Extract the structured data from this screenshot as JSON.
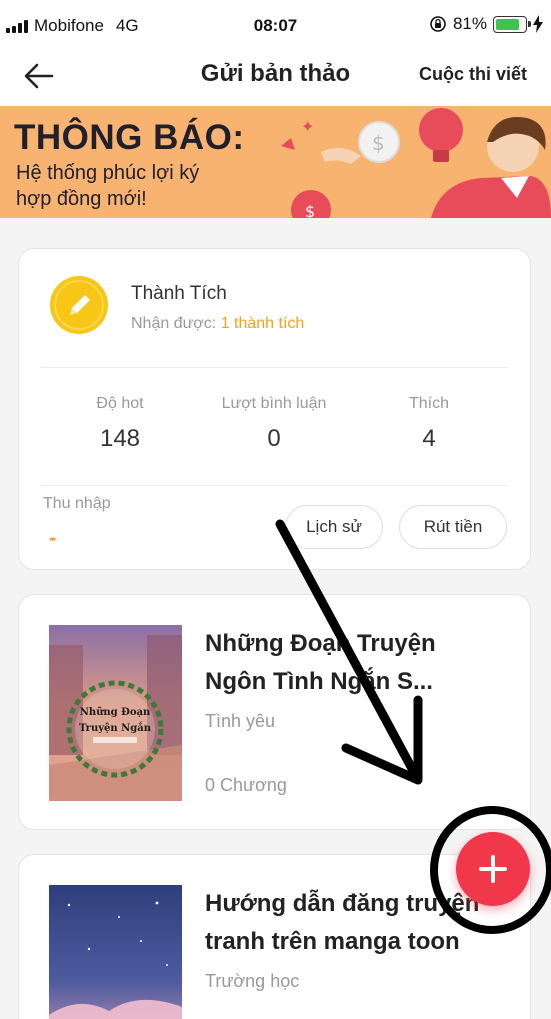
{
  "status_bar": {
    "carrier": "Mobifone",
    "network": "4G",
    "time": "08:07",
    "battery_percent": "81%",
    "battery_level": 0.81,
    "battery_color": "#3cc54a"
  },
  "nav": {
    "back_icon": "arrow-left-icon",
    "title": "Gửi bản thảo",
    "right_link": "Cuộc thi viết"
  },
  "banner": {
    "title": "THÔNG BÁO:",
    "subtitle_line1": "Hệ thống phúc lợi ký",
    "subtitle_line2": "hợp đồng mới!",
    "background": "#f8b370"
  },
  "achievement": {
    "icon": "pencil-badge-icon",
    "title": "Thành Tích",
    "received_label": "Nhận được: ",
    "received_value": "1 thành tích",
    "stats": [
      {
        "label": "Độ hot",
        "value": "148"
      },
      {
        "label": "Lượt bình luận",
        "value": "0"
      },
      {
        "label": "Thích",
        "value": "4"
      }
    ],
    "income_label": "Thu nhập",
    "income_value": "-",
    "history_button": "Lịch sử",
    "withdraw_button": "Rút tiền",
    "accent_color": "#f3a21a"
  },
  "stories": [
    {
      "title_line1": "Những Đoạn Truyện",
      "title_line2": "Ngôn Tình Ngắn S...",
      "genre": "Tình yêu",
      "chapters": "0 Chương",
      "cover_text_line1": "Những Đoạn",
      "cover_text_line2": "Truyện Ngắn"
    },
    {
      "title_line1": "Hướng dẫn đăng truyện",
      "title_line2": "tranh trên manga toon",
      "genre": "Trường học"
    }
  ],
  "fab": {
    "icon": "plus-icon",
    "color": "#f0384a"
  }
}
